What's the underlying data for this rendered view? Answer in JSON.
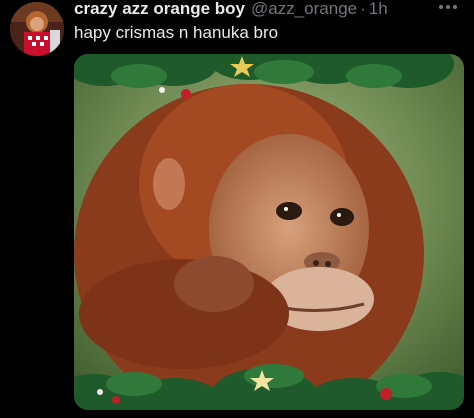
{
  "tweet": {
    "display_name": "crazy azz orange boy",
    "handle": "@azz_orange",
    "separator": "·",
    "timestamp": "1h",
    "text": "hapy crismas n hanuka bro",
    "more_icon": "more-dots-icon",
    "media_description_icon": "orangutan-christmas-photo"
  },
  "colors": {
    "background": "#000000",
    "primary_text": "#e7e9ea",
    "secondary_text": "#71767b"
  }
}
